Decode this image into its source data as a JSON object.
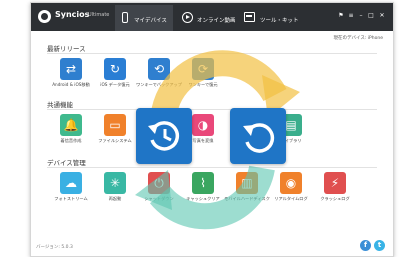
{
  "app": {
    "name": "Syncios",
    "edition": "Ultimate"
  },
  "tabs": [
    {
      "label": "マイデバイス",
      "icon": "phone-icon",
      "active": true
    },
    {
      "label": "オンライン動画",
      "icon": "play-icon",
      "active": false
    },
    {
      "label": "ツール・キット",
      "icon": "toolbox-icon",
      "active": false
    }
  ],
  "window_controls": [
    "flag-icon",
    "menu-icon",
    "minimize-icon",
    "maximize-icon",
    "close-icon"
  ],
  "selected_device": "現在のデバイス: iPhone",
  "sections": [
    {
      "title": "最新リリース",
      "items": [
        {
          "label": "Android & iOS移動",
          "icon": "swap-arrows-icon",
          "color": "#2f7fcf"
        },
        {
          "label": "iOS データ復元",
          "icon": "restore-icon",
          "color": "#2a7ed4"
        },
        {
          "label": "ワンキーでバックアップ",
          "icon": "backup-icon",
          "color": "#2f7fcf"
        },
        {
          "label": "ワンキーで復元",
          "icon": "restore-icon",
          "color": "#2f7fcf"
        }
      ]
    },
    {
      "title": "共通機能",
      "items": [
        {
          "label": "着信音作成",
          "icon": "bell-icon",
          "color": "#3fb98d"
        },
        {
          "label": "ファイルシステム",
          "icon": "folder-icon",
          "color": "#f0812b"
        },
        {
          "label": "",
          "icon": "restore-icon",
          "color": "#e9487a"
        },
        {
          "label": "写真を変換",
          "icon": "photo-icon",
          "color": "#e9487a"
        },
        {
          "label": "",
          "icon": "restore-icon",
          "color": "#2f7fcf"
        },
        {
          "label": "ライブラリ",
          "icon": "library-icon",
          "color": "#3aae8c"
        }
      ]
    },
    {
      "title": "デバイス管理",
      "items": [
        {
          "label": "フォトストリーム",
          "icon": "cloud-icon",
          "color": "#3ab0e3"
        },
        {
          "label": "再起動",
          "icon": "loading-icon",
          "color": "#39b8a4"
        },
        {
          "label": "シャットダウン",
          "icon": "power-icon",
          "color": "#e04f4f"
        },
        {
          "label": "キャッシュクリア",
          "icon": "broom-icon",
          "color": "#3aa660"
        },
        {
          "label": "モバイルハードディスク",
          "icon": "disk-icon",
          "color": "#f0812b"
        },
        {
          "label": "リアルタイムログ",
          "icon": "log-icon",
          "color": "#f0812b"
        },
        {
          "label": "クラッシュログ",
          "icon": "crash-log-icon",
          "color": "#e04f4f"
        }
      ]
    }
  ],
  "footer": {
    "version": "バージョン: 5.0.3"
  },
  "social": [
    "facebook-icon",
    "twitter-icon"
  ],
  "overlay": {
    "big_icons": [
      "backup-icon",
      "restore-icon"
    ]
  }
}
